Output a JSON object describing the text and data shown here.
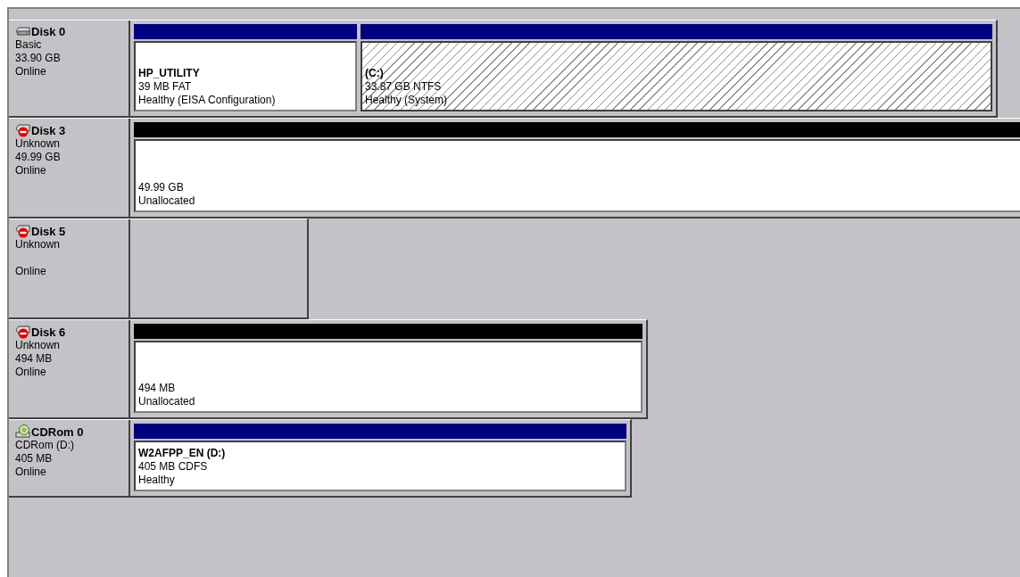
{
  "disks": [
    {
      "kind": "disk",
      "name": "Disk 0",
      "type": "Basic",
      "size": "33.90 GB",
      "status": "Online",
      "partitions": [
        {
          "kind": "primary",
          "selected": false,
          "name": "HP_UTILITY",
          "detail": "39 MB FAT",
          "status": "Healthy (EISA Configuration)"
        },
        {
          "kind": "primary",
          "selected": true,
          "name": "(C:)",
          "detail": "33.87 GB NTFS",
          "status": "Healthy (System)"
        }
      ]
    },
    {
      "kind": "disk-error",
      "name": "Disk 3",
      "type": "Unknown",
      "size": "49.99 GB",
      "status": "Online",
      "partitions": [
        {
          "kind": "unallocated",
          "selected": false,
          "detail": "49.99 GB",
          "status": "Unallocated"
        }
      ]
    },
    {
      "kind": "disk-error",
      "name": "Disk 5",
      "type": "Unknown",
      "status": "Online"
    },
    {
      "kind": "disk-error",
      "name": "Disk 6",
      "type": "Unknown",
      "size": "494 MB",
      "status": "Online",
      "partitions": [
        {
          "kind": "unallocated",
          "selected": false,
          "detail": "494 MB",
          "status": "Unallocated"
        }
      ]
    },
    {
      "kind": "cdrom",
      "name": "CDRom 0",
      "type": "CDRom (D:)",
      "size": "405 MB",
      "status": "Online",
      "partitions": [
        {
          "kind": "primary",
          "selected": false,
          "name": "W2AFPP_EN  (D:)",
          "detail": "405 MB CDFS",
          "status": "Healthy"
        }
      ]
    }
  ]
}
